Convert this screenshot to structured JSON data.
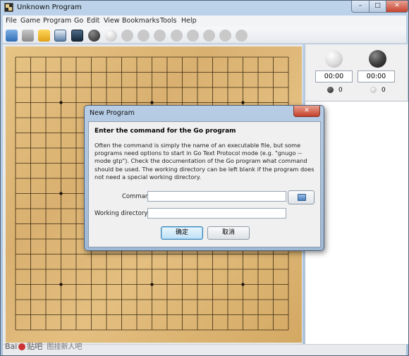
{
  "window": {
    "title": "Unknown Program",
    "minimize": "–",
    "maximize": "□",
    "close": "✕"
  },
  "menu": [
    "File",
    "Game",
    "Program",
    "Go",
    "Edit",
    "View",
    "Bookmarks",
    "Tools",
    "Help"
  ],
  "toolbar_icons": [
    "new-game-icon",
    "open-icon",
    "save-icon",
    "close-file-icon",
    "board-setup-icon",
    "play-black-icon",
    "play-white-icon",
    "beginning-icon",
    "back-10-icon",
    "back-icon",
    "forward-icon",
    "forward-10-icon",
    "end-icon",
    "variation-icon"
  ],
  "board": {
    "size": 19,
    "star_points": true
  },
  "side_panel": {
    "white_clock": "00:00",
    "black_clock": "00:00",
    "black_captures": "0",
    "white_captures": "0"
  },
  "dialog": {
    "title": "New Program",
    "close": "✕",
    "heading": "Enter the command for the Go program",
    "description": "Often the command is simply the name of an executable file, but some programs need options to start in Go Text Protocol mode (e.g. \"gnugo --mode gtp\"). Check the documentation of the Go program what command should be used. The working directory can be left blank if the program does not need a special working directory.",
    "command_label": "Command:",
    "command_value": "",
    "workdir_label": "Working directory:",
    "workdir_value": "",
    "ok_label": "确定",
    "cancel_label": "取消"
  },
  "watermark": {
    "logo": "Bai",
    "logo2": "贴吧",
    "sub": "图挂新人吧"
  },
  "colors": {
    "board": "#ddb575",
    "title_bar": "#b7cde5",
    "ok_border": "#3c7fb1",
    "close_red": "#c4402b"
  }
}
